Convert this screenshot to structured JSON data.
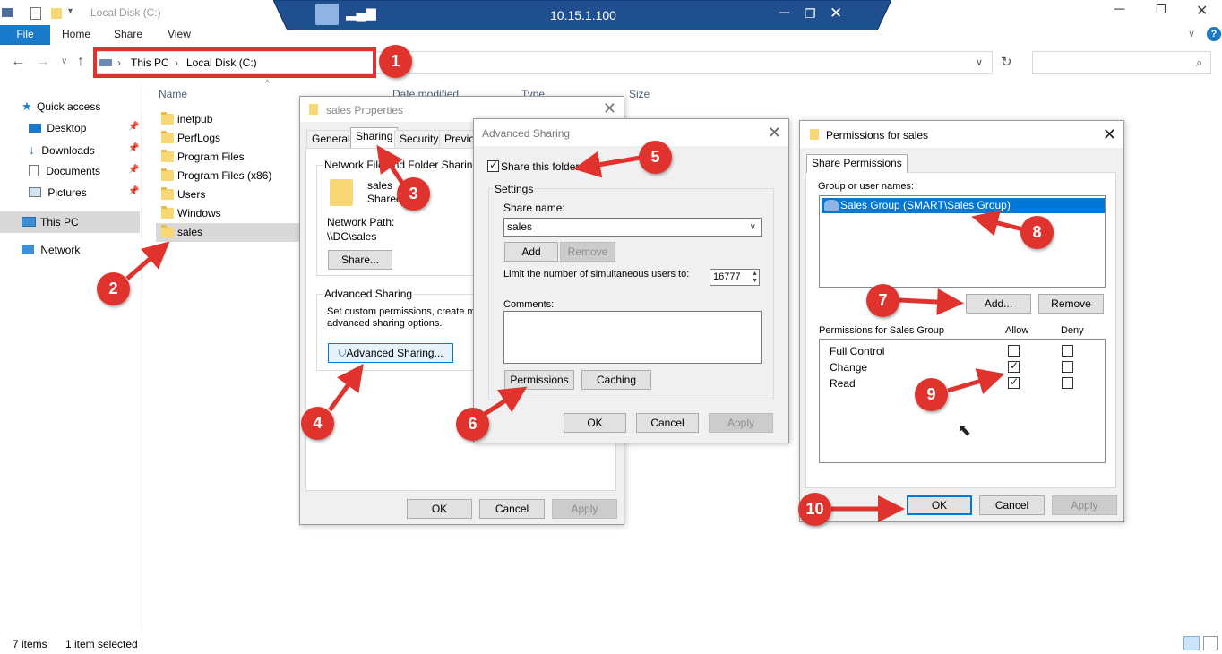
{
  "window": {
    "title": "Local Disk (C:)",
    "remote_host": "10.15.1.100"
  },
  "ribbon": {
    "tabs": [
      "File",
      "Home",
      "Share",
      "View"
    ]
  },
  "address": {
    "crumbs": [
      "This PC",
      "Local Disk (C:)"
    ]
  },
  "nav": {
    "items": [
      {
        "label": "Quick access",
        "icon": "star-icon"
      },
      {
        "label": "Desktop",
        "icon": "desktop-icon"
      },
      {
        "label": "Downloads",
        "icon": "download-icon"
      },
      {
        "label": "Documents",
        "icon": "documents-icon"
      },
      {
        "label": "Pictures",
        "icon": "pictures-icon"
      },
      {
        "label": "This PC",
        "icon": "computer-icon"
      },
      {
        "label": "Network",
        "icon": "network-icon"
      }
    ]
  },
  "content": {
    "columns": [
      "Name",
      "Date modified",
      "Type",
      "Size"
    ],
    "files": [
      "inetpub",
      "PerfLogs",
      "Program Files",
      "Program Files (x86)",
      "Users",
      "Windows",
      "sales"
    ],
    "selected": "sales"
  },
  "status": {
    "count": "7 items",
    "selection": "1 item selected"
  },
  "props": {
    "title": "sales Properties",
    "tabs": [
      "General",
      "Sharing",
      "Security",
      "Previou"
    ],
    "network_group": "Network File and Folder Sharing",
    "folder_name": "sales",
    "folder_state": "Shared",
    "path_label": "Network Path:",
    "path_value": "\\\\DC\\sales",
    "share_button": "Share...",
    "adv_group": "Advanced Sharing",
    "adv_desc_1": "Set custom permissions, create mul",
    "adv_desc_2": "advanced sharing options.",
    "adv_button": "Advanced Sharing...",
    "ok": "OK",
    "cancel": "Cancel",
    "apply": "Apply"
  },
  "adv": {
    "title": "Advanced Sharing",
    "share_check": "Share this folder",
    "settings": "Settings",
    "share_name_label": "Share name:",
    "share_name": "sales",
    "add": "Add",
    "remove": "Remove",
    "limit_label": "Limit the number of simultaneous users to:",
    "limit_value": "16777",
    "comments_label": "Comments:",
    "permissions": "Permissions",
    "caching": "Caching",
    "ok": "OK",
    "cancel": "Cancel",
    "apply": "Apply"
  },
  "perm": {
    "title": "Permissions for sales",
    "tab": "Share Permissions",
    "group_label": "Group or user names:",
    "group_entry": "Sales Group (SMART\\Sales Group)",
    "add": "Add...",
    "remove": "Remove",
    "perm_label": "Permissions for Sales Group",
    "allow": "Allow",
    "deny": "Deny",
    "rows": [
      {
        "name": "Full Control",
        "allow": false,
        "deny": false
      },
      {
        "name": "Change",
        "allow": true,
        "deny": false
      },
      {
        "name": "Read",
        "allow": true,
        "deny": false
      }
    ],
    "ok": "OK",
    "cancel": "Cancel",
    "apply": "Apply"
  },
  "steps": [
    "1",
    "2",
    "3",
    "4",
    "5",
    "6",
    "7",
    "8",
    "9",
    "10"
  ],
  "colors": {
    "accent": "#0078d7",
    "badge": "#e0332d",
    "rdp": "#1f4f8f"
  }
}
